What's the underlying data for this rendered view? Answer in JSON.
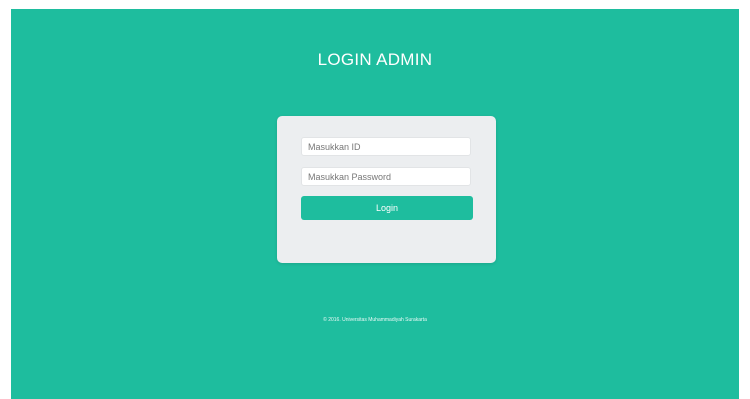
{
  "page": {
    "title": "LOGIN ADMIN",
    "footer": "© 2016. Universitas Muhammadiyah Surakarta"
  },
  "form": {
    "id_placeholder": "Masukkan ID",
    "id_value": "",
    "password_placeholder": "Masukkan Password",
    "password_value": "",
    "login_label": "Login"
  },
  "colors": {
    "background": "#1ebd9e",
    "card": "#eceef0",
    "button": "#1ebd9e",
    "text_light": "#ffffff"
  }
}
